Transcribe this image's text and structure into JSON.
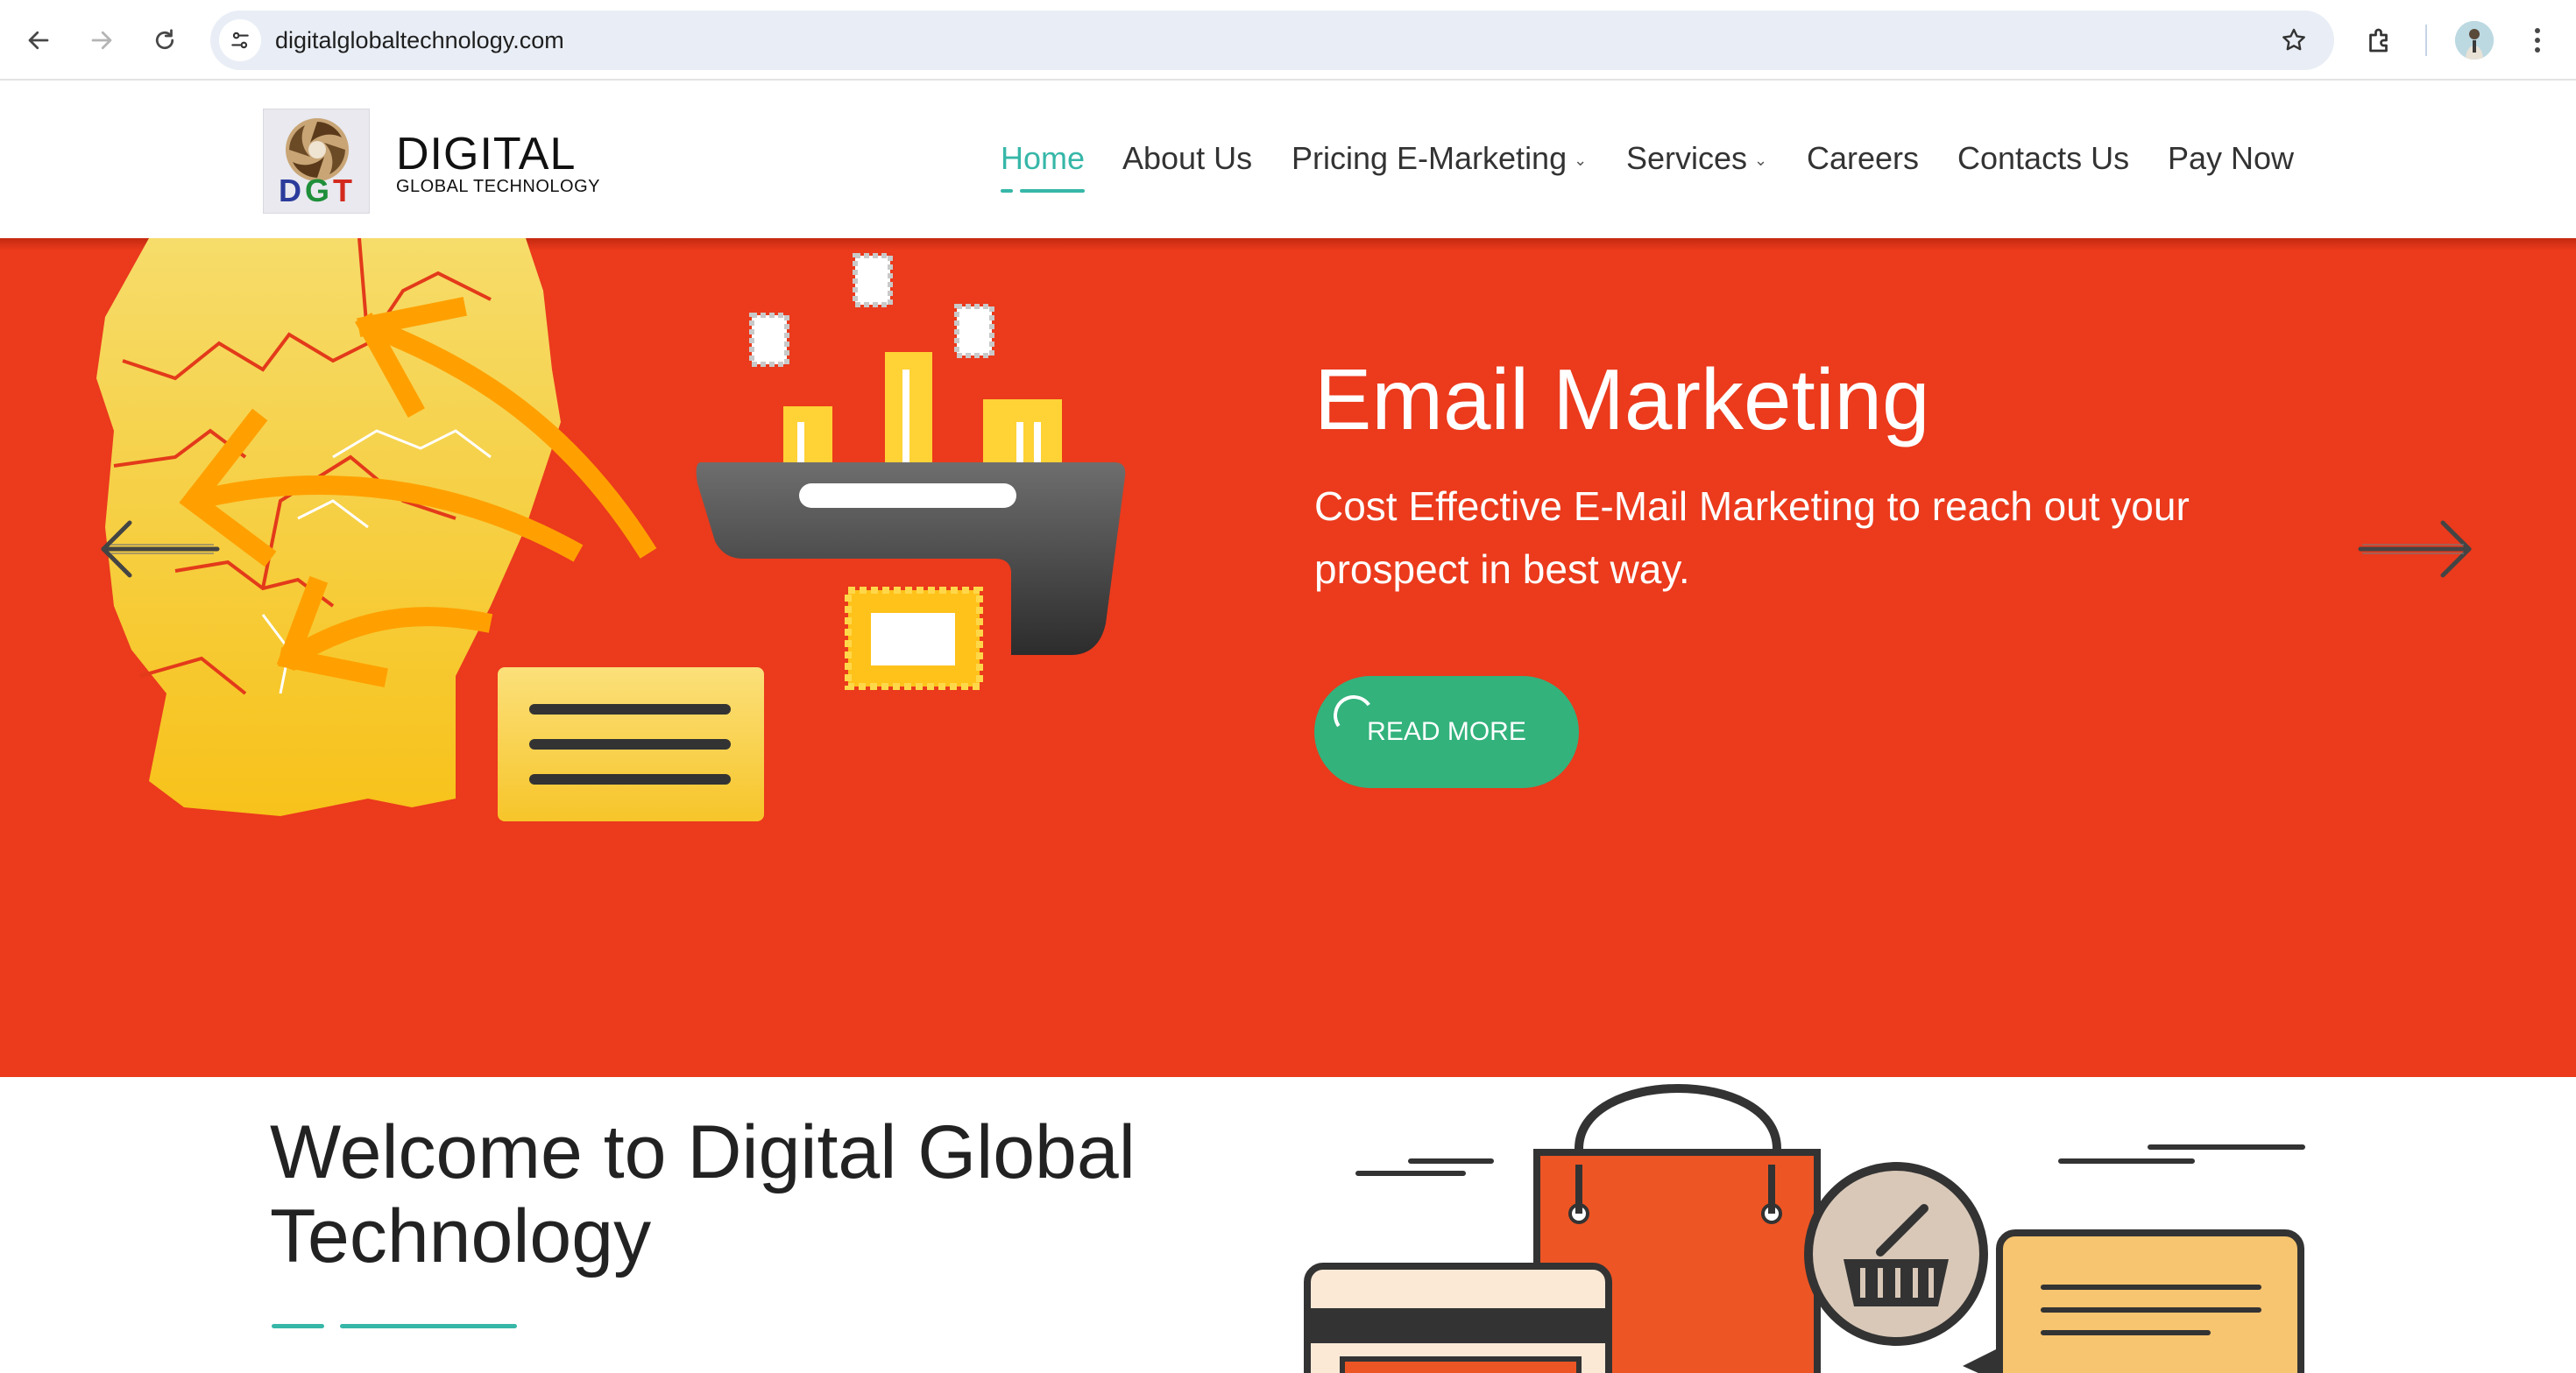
{
  "browser": {
    "url": "digitalglobaltechnology.com",
    "icons": [
      "back-arrow-icon",
      "forward-arrow-icon",
      "reload-icon",
      "site-settings-icon",
      "bookmark-star-icon",
      "extensions-puzzle-icon",
      "profile-avatar-icon",
      "more-menu-icon"
    ]
  },
  "header": {
    "logo_text": "DGT",
    "brand_name": "DIGITAL",
    "brand_sub": "GLOBAL TECHNOLOGY",
    "nav": [
      {
        "label": "Home",
        "active": true
      },
      {
        "label": "About Us"
      },
      {
        "label": "Pricing E-Marketing",
        "dropdown": true
      },
      {
        "label": "Services",
        "dropdown": true
      },
      {
        "label": "Careers"
      },
      {
        "label": "Contacts Us"
      },
      {
        "label": "Pay Now"
      }
    ],
    "caret": "⌄"
  },
  "hero": {
    "title": "Email Marketing",
    "description": "Cost Effective E-Mail Marketing to reach out your prospect in best way.",
    "button_label": "READ MORE",
    "background_color": "#eb3a1c",
    "button_color": "#33b27c"
  },
  "welcome": {
    "title": "Welcome to Digital Global Technology"
  },
  "colors": {
    "accent": "#36b7a8"
  }
}
